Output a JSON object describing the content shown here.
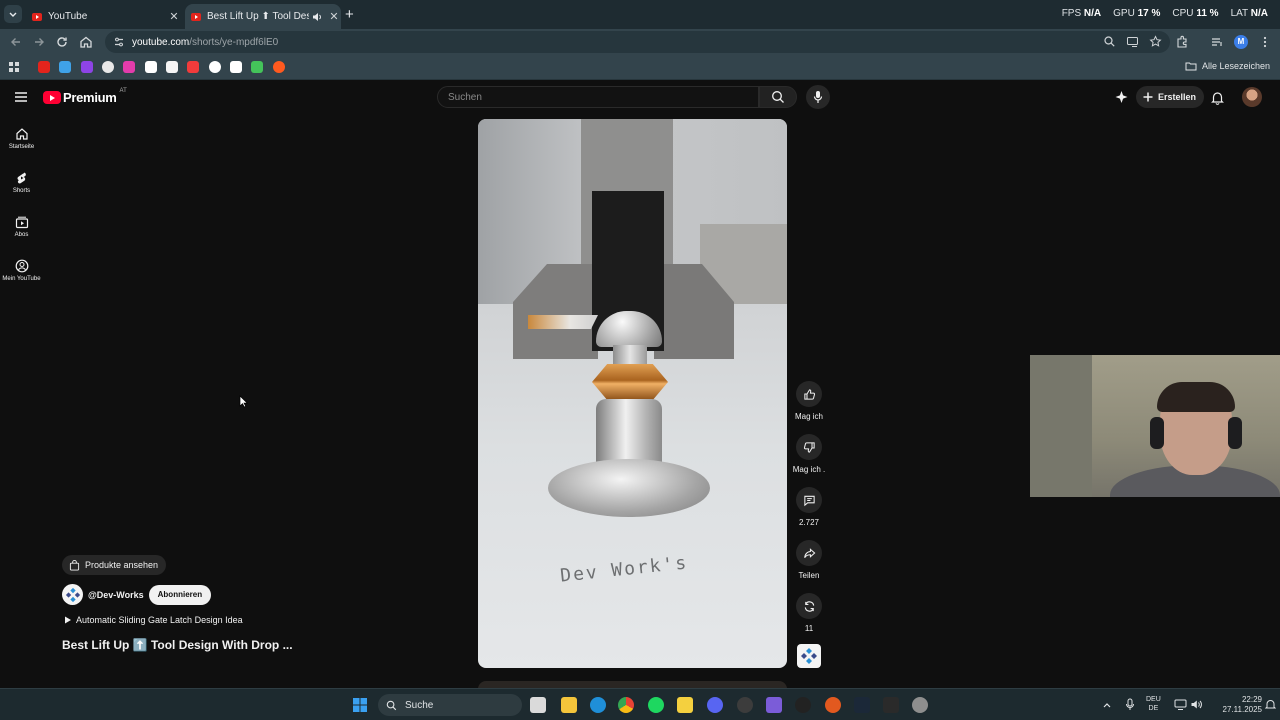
{
  "browser": {
    "tabs": [
      {
        "title": "YouTube",
        "active": false
      },
      {
        "title": "Best Lift Up ⬆ Tool Design W",
        "active": true
      }
    ],
    "stats": [
      {
        "label": "FPS",
        "value": "N/A"
      },
      {
        "label": "GPU",
        "value": "17 %"
      },
      {
        "label": "CPU",
        "value": "11 %"
      },
      {
        "label": "LAT",
        "value": "N/A"
      }
    ],
    "url_host": "youtube.com",
    "url_path": "/shorts/ye-mpdf6lE0",
    "profile_initial": "M",
    "bookmarks_all": "Alle Lesezeichen",
    "bookmark_colors": [
      "#e3241c",
      "#3fa2e8",
      "#8d44e6",
      "#e8e8e8",
      "#e33cab",
      "#ffffff",
      "#f5f5f5",
      "#f23b3b",
      "#ffffff",
      "#ffffff",
      "#44c35a",
      "#ff5a1f"
    ]
  },
  "youtube": {
    "logo_text": "Premium",
    "logo_country": "AT",
    "search_placeholder": "Suchen",
    "create_label": "Erstellen",
    "sidebar": [
      {
        "label": "Startseite",
        "icon": "home-icon"
      },
      {
        "label": "Shorts",
        "icon": "shorts-icon"
      },
      {
        "label": "Abos",
        "icon": "subscriptions-icon"
      },
      {
        "label": "Mein YouTube",
        "icon": "account-icon"
      }
    ],
    "video": {
      "watermark": "Dev Work's"
    },
    "actions": {
      "like": "Mag ich",
      "dislike": "Mag ich .",
      "comments": "2.727",
      "share": "Teilen",
      "remix": "11"
    },
    "overlay": {
      "products": "Produkte ansehen",
      "channel": "@Dev-Works",
      "subscribe": "Abonnieren",
      "music": "Automatic Sliding Gate Latch Design Idea",
      "title": "Best Lift Up ⬆️ Tool Design With Drop ..."
    }
  },
  "taskbar": {
    "search": "Suche",
    "lang_top": "DEU",
    "lang_bottom": "DE",
    "time": "22:29",
    "date": "27.11.2025"
  }
}
